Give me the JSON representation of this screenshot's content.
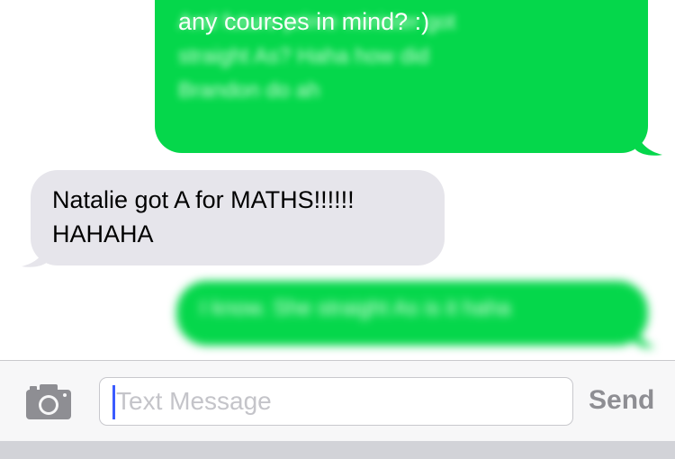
{
  "thread": {
    "messages": [
      {
        "id": "m1",
        "direction": "sent",
        "visible_line": "any courses in mind? :)",
        "blurred_text": "And future prime minister got\nstraight As? Haha how did\nBrandon do ah"
      },
      {
        "id": "m2",
        "direction": "received",
        "text": "Natalie got A for MATHS!!!!!!\nHAHAHA"
      },
      {
        "id": "m3",
        "direction": "sent",
        "blurred_text": "I know. She straight As is it haha"
      }
    ]
  },
  "input_bar": {
    "placeholder": "Text Message",
    "send_label": "Send",
    "camera_icon": "camera-icon"
  },
  "colors": {
    "sent_bubble": "#05d74b",
    "received_bubble": "#e6e5eb",
    "caret": "#3b5bff",
    "send_disabled": "#8e8e93"
  }
}
